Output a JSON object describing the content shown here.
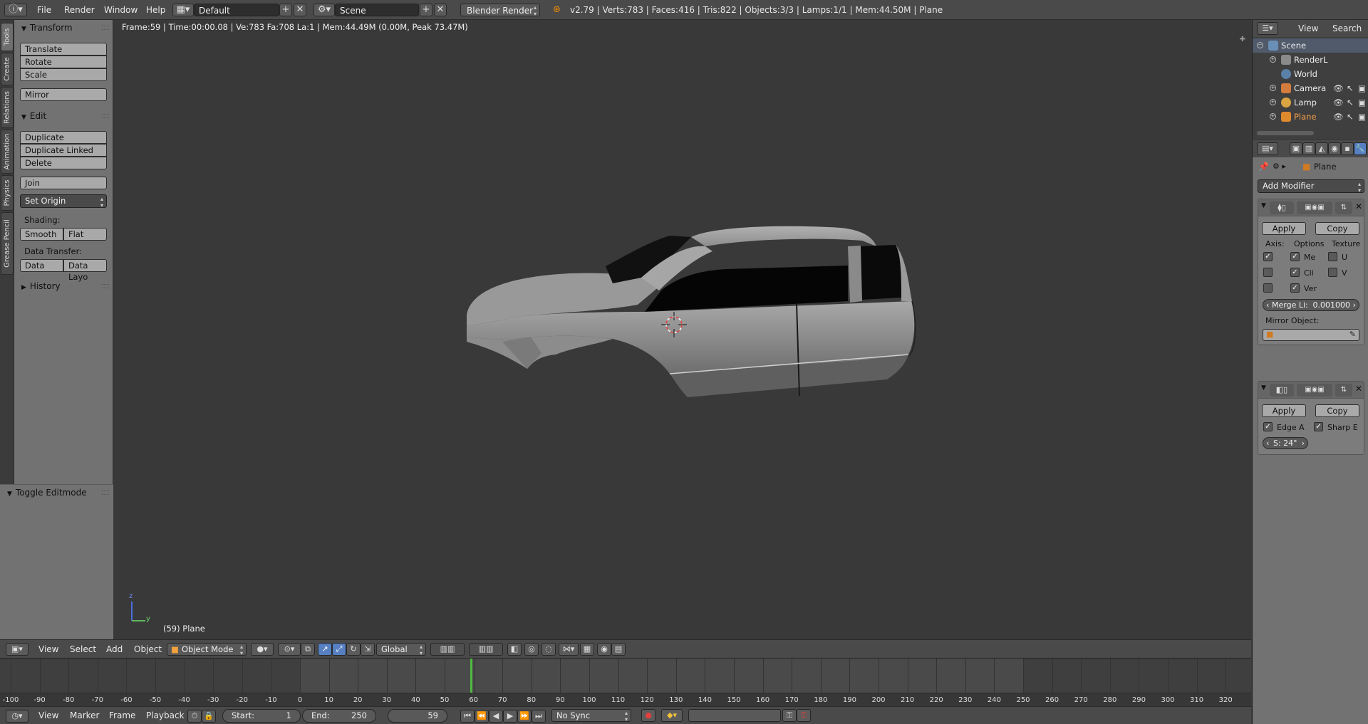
{
  "top_header": {
    "menus": [
      "File",
      "Render",
      "Window",
      "Help"
    ],
    "layout": "Default",
    "scene": "Scene",
    "engine": "Blender Render",
    "stats": "v2.79 | Verts:783 | Faces:416 | Tris:822 | Objects:3/3 | Lamps:1/1 | Mem:44.50M | Plane"
  },
  "left_tabs": [
    "Tools",
    "Create",
    "Relations",
    "Animation",
    "Physics",
    "Grease Pencil"
  ],
  "tool_shelf": {
    "transform": {
      "title": "Transform",
      "buttons": [
        "Translate",
        "Rotate",
        "Scale"
      ],
      "mirror": "Mirror"
    },
    "edit": {
      "title": "Edit",
      "buttons": [
        "Duplicate",
        "Duplicate Linked",
        "Delete"
      ],
      "join": "Join",
      "set_origin": "Set Origin",
      "shading_label": "Shading:",
      "smooth": "Smooth",
      "flat": "Flat",
      "data_transfer_label": "Data Transfer:",
      "data": "Data",
      "data_layout": "Data Layo"
    },
    "history": "History",
    "toggle_editmode": "Toggle Editmode"
  },
  "viewport": {
    "info": "Frame:59 | Time:00:00.08 | Ve:783 Fa:708 La:1 | Mem:44.49M (0.00M, Peak 73.47M)",
    "object_label": "(59) Plane",
    "axis_z": "z",
    "axis_y": "y"
  },
  "viewport_header": {
    "menus": [
      "View",
      "Select",
      "Add",
      "Object"
    ],
    "mode": "Object Mode",
    "orientation": "Global"
  },
  "timeline": {
    "ticks": [
      "-100",
      "-90",
      "-80",
      "-70",
      "-60",
      "-50",
      "-40",
      "-30",
      "-20",
      "-10",
      "0",
      "10",
      "20",
      "30",
      "40",
      "50",
      "60",
      "70",
      "80",
      "90",
      "100",
      "110",
      "120",
      "130",
      "140",
      "150",
      "160",
      "170",
      "180",
      "190",
      "200",
      "210",
      "220",
      "230",
      "240",
      "250",
      "260",
      "270",
      "280",
      "290",
      "300",
      "310",
      "320"
    ],
    "current_frame_value": 59
  },
  "bottom_header": {
    "menus": [
      "View",
      "Marker",
      "Frame",
      "Playback"
    ],
    "start_label": "Start:",
    "start_value": "1",
    "end_label": "End:",
    "end_value": "250",
    "current": "59",
    "sync": "No Sync"
  },
  "outliner": {
    "menus": [
      "View",
      "Search"
    ],
    "rows": [
      {
        "label": "Scene",
        "icon": "scene-icon"
      },
      {
        "label": "RenderL",
        "icon": "render-layers-icon"
      },
      {
        "label": "World",
        "icon": "world-icon"
      },
      {
        "label": "Camera",
        "icon": "camera-icon"
      },
      {
        "label": "Lamp",
        "icon": "lamp-icon"
      },
      {
        "label": "Plane",
        "icon": "mesh-icon"
      }
    ]
  },
  "properties": {
    "breadcrumb": "Plane",
    "add_modifier": "Add Modifier",
    "apply": "Apply",
    "copy": "Copy",
    "mirror_mod": {
      "axis": "Axis:",
      "options": "Options",
      "texture": "Texture",
      "opt1": "Me",
      "opt2": "Cli",
      "opt3": "Ver",
      "tex1": "U",
      "tex2": "V",
      "merge_label": "Merge Li:",
      "merge_value": "0.001000",
      "mirror_object": "Mirror Object:"
    },
    "edge_split": {
      "edge": "Edge A",
      "sharp": "Sharp E",
      "angle": "S: 24°"
    }
  },
  "colors": {
    "accent_blue": "#5680c2",
    "frame_cursor": "#4fba40",
    "selection": "#f28c00"
  }
}
